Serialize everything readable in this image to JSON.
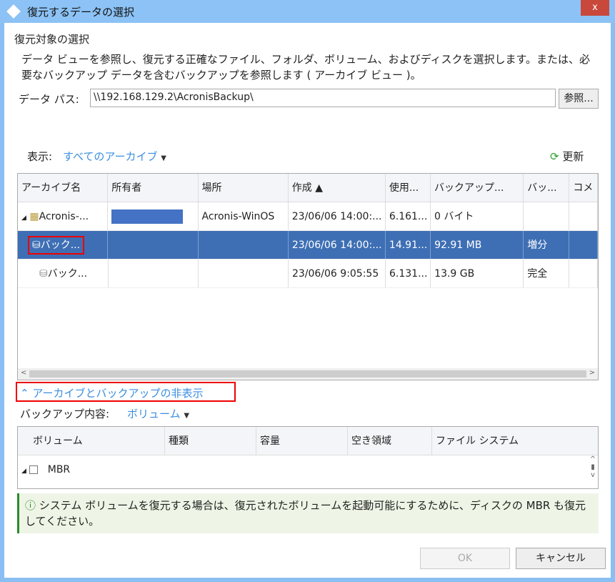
{
  "window": {
    "title": "復元するデータの選択",
    "close": "x"
  },
  "section_title": "復元対象の選択",
  "description": "データ ビューを参照し、復元する正確なファイル、フォルダ、ボリューム、およびディスクを選択します。または、必要なバックアップ データを含むバックアップを参照します ( アーカイブ ビュー )。",
  "data_path": {
    "label": "データ パス:",
    "value": "\\\\192.168.129.2\\AcronisBackup\\",
    "browse": "参照..."
  },
  "view": {
    "label": "表示:",
    "value": "すべてのアーカイブ",
    "refresh": "更新"
  },
  "archives": {
    "columns": [
      "アーカイブ名",
      "所有者",
      "場所",
      "作成 ▲",
      "使用...",
      "バックアップ...",
      "バッ...",
      "コメ"
    ],
    "rows": [
      {
        "name": "Acronis-...",
        "owner": "",
        "location": "Acronis-WinOS",
        "created": "23/06/06 14:00:...",
        "used": "6.161...",
        "backup": "0 バイト",
        "type": ""
      },
      {
        "name": "バック...",
        "owner": "",
        "location": "",
        "created": "23/06/06 14:00:...",
        "used": "14.91...",
        "backup": "92.91 MB",
        "type": "増分"
      },
      {
        "name": "バック...",
        "owner": "",
        "location": "",
        "created": "23/06/06 9:05:55",
        "used": "6.131...",
        "backup": "13.9 GB",
        "type": "完全"
      }
    ]
  },
  "hide_link": "アーカイブとバックアップの非表示",
  "content": {
    "label": "バックアップ内容:",
    "value": "ボリューム"
  },
  "volumes": {
    "columns": [
      "ボリューム",
      "種類",
      "容量",
      "空き領域",
      "ファイル システム"
    ],
    "rows": [
      {
        "name": "MBR"
      }
    ]
  },
  "info": "システム ボリュームを復元する場合は、復元されたボリュームを起動可能にするために、ディスクの MBR も復元してください。",
  "buttons": {
    "ok": "OK",
    "cancel": "キャンセル"
  }
}
